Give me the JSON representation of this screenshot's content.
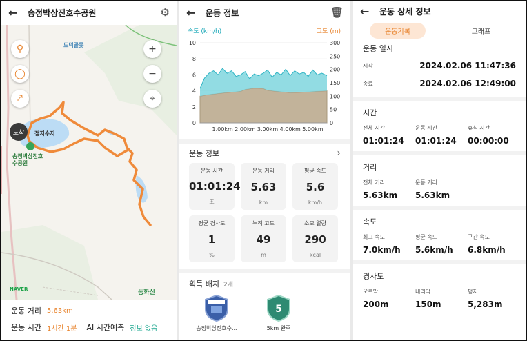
{
  "panel1": {
    "title": "송정박상진호수공원",
    "map": {
      "place_label": "도덕골못",
      "lake_label": "정지수지",
      "park_label": "송정박상진호수공원",
      "arrival_label": "도착",
      "naver_label": "NAVER",
      "provider_label": "동화신"
    },
    "stats": {
      "distance_label": "운동 거리",
      "distance_value": "5.63km",
      "time_label": "운동 시간",
      "time_value": "1시간 1분",
      "ai_label": "AI 시간예측",
      "ai_value": "정보 없음"
    }
  },
  "panel2": {
    "title": "운동 정보",
    "legend_left": "속도 (km/h)",
    "legend_right": "고도 (m)",
    "section_title": "운동 정보",
    "cards": [
      {
        "label": "운동 시간",
        "value": "01:01:24",
        "unit": "초"
      },
      {
        "label": "운동 거리",
        "value": "5.63",
        "unit": "km"
      },
      {
        "label": "평균 속도",
        "value": "5.6",
        "unit": "km/h"
      },
      {
        "label": "평균 경사도",
        "value": "1",
        "unit": "%"
      },
      {
        "label": "누적 고도",
        "value": "49",
        "unit": "m"
      },
      {
        "label": "소모 열량",
        "value": "290",
        "unit": "kcal"
      }
    ],
    "badges_title": "획득 배지",
    "badges_count": "2개",
    "badges": [
      {
        "name": "송정박상진호수...",
        "top_text": "수변공원"
      },
      {
        "name": "5km 완주",
        "top_text": "5"
      }
    ]
  },
  "chart_data": {
    "type": "area",
    "title": "",
    "x_ticks": [
      "1.00km",
      "2.00km",
      "3.00km",
      "4.00km",
      "5.00km"
    ],
    "xlim": [
      0,
      5.63
    ],
    "y_left": {
      "label": "속도 (km/h)",
      "lim": [
        0,
        10
      ],
      "ticks": [
        0,
        2,
        4,
        6,
        8,
        10
      ]
    },
    "y_right": {
      "label": "고도 (m)",
      "lim": [
        0,
        300
      ],
      "ticks": [
        0,
        50,
        100,
        150,
        200,
        250,
        300
      ]
    },
    "series": [
      {
        "name": "속도 (km/h)",
        "axis": "left",
        "color": "#7fd6de",
        "x": [
          0,
          0.2,
          0.4,
          0.6,
          0.8,
          1.0,
          1.2,
          1.4,
          1.6,
          1.8,
          2.0,
          2.2,
          2.4,
          2.6,
          2.8,
          3.0,
          3.2,
          3.4,
          3.6,
          3.8,
          4.0,
          4.2,
          4.4,
          4.6,
          4.8,
          5.0,
          5.2,
          5.4,
          5.63
        ],
        "y": [
          4.3,
          5.6,
          6.2,
          6.5,
          6.0,
          6.8,
          6.2,
          6.5,
          5.8,
          6.0,
          6.4,
          5.5,
          6.1,
          5.9,
          6.2,
          6.6,
          5.7,
          6.3,
          6.0,
          6.7,
          5.9,
          6.5,
          6.1,
          6.3,
          5.8,
          6.6,
          6.0,
          6.2,
          5.9
        ]
      },
      {
        "name": "고도 (m)",
        "axis": "right",
        "color": "#c2b39a",
        "x": [
          0,
          0.3,
          0.6,
          1.0,
          1.4,
          1.8,
          2.0,
          2.4,
          2.8,
          3.0,
          3.4,
          3.8,
          4.0,
          4.4,
          4.8,
          5.2,
          5.63
        ],
        "y": [
          100,
          105,
          108,
          112,
          115,
          118,
          125,
          130,
          129,
          122,
          118,
          115,
          113,
          114,
          116,
          118,
          120
        ]
      }
    ]
  },
  "panel3": {
    "title": "운동 상세 정보",
    "tab_active": "운동기록",
    "tab_other": "그래프",
    "datetime": {
      "title": "운동 일시",
      "start_label": "시작",
      "start_value": "2024.02.06 11:47:36",
      "end_label": "종료",
      "end_value": "2024.02.06 12:49:00"
    },
    "time": {
      "title": "시간",
      "items": [
        {
          "label": "전체 시간",
          "value": "01:01:24"
        },
        {
          "label": "운동 시간",
          "value": "01:01:24"
        },
        {
          "label": "휴식 시간",
          "value": "00:00:00"
        }
      ]
    },
    "distance": {
      "title": "거리",
      "items": [
        {
          "label": "전체 거리",
          "value": "5.63km"
        },
        {
          "label": "운동 거리",
          "value": "5.63km"
        }
      ]
    },
    "speed": {
      "title": "속도",
      "items": [
        {
          "label": "최고 속도",
          "value": "7.0km/h"
        },
        {
          "label": "평균 속도",
          "value": "5.6km/h"
        },
        {
          "label": "구간 속도",
          "value": "6.8km/h"
        }
      ]
    },
    "slope": {
      "title": "경사도",
      "items": [
        {
          "label": "오르막",
          "value": "200m"
        },
        {
          "label": "내리막",
          "value": "150m"
        },
        {
          "label": "평지",
          "value": "5,283m"
        }
      ]
    }
  }
}
